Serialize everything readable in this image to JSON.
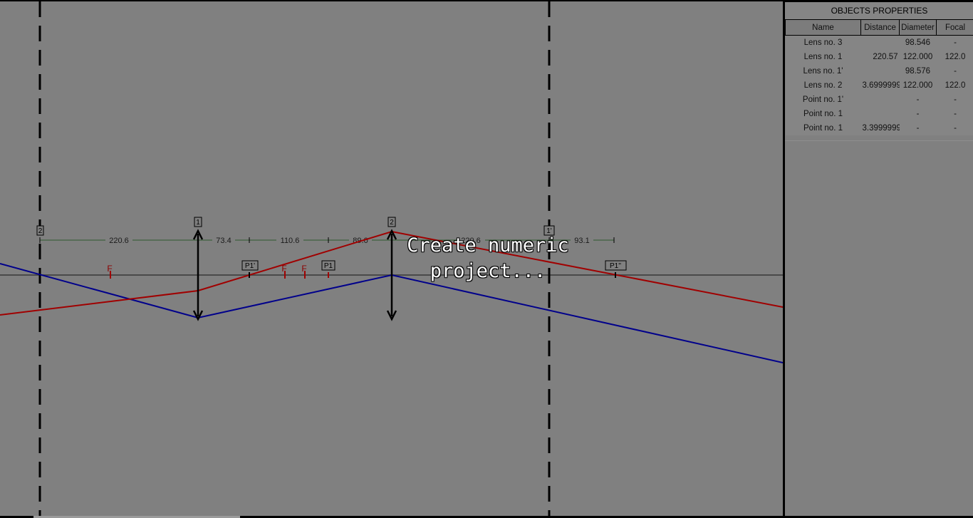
{
  "canvas": {
    "overlay_text": "Create numeric\nproject...",
    "lens_tags": [
      "2",
      "1",
      "2",
      "1'"
    ],
    "distances": [
      "220.6",
      "73.4",
      "110.6",
      "89.0",
      "220.6",
      "93.1"
    ],
    "point_tags": [
      "P1'",
      "P1",
      "P1''"
    ],
    "focal_labels": [
      "F",
      "F",
      "F"
    ],
    "colors": {
      "background": "#808080",
      "ray_red": "#a00000",
      "ray_blue": "#00008b",
      "dim_line": "#2e5a2e"
    }
  },
  "panel": {
    "title": "OBJECTS PROPERTIES",
    "columns": [
      "Name",
      "Distance",
      "Diameter",
      "Focal"
    ],
    "rows": [
      [
        "Lens no. 3",
        "",
        "98.546",
        "-"
      ],
      [
        "Lens no. 1",
        "220.57",
        "122.000",
        "122.0"
      ],
      [
        "Lens no. 1'",
        "",
        "98.576",
        "-"
      ],
      [
        "Lens no. 2",
        "3.699999999",
        "122.000",
        "122.0"
      ],
      [
        "Point no. 1'",
        "",
        "-",
        "-"
      ],
      [
        "Point no. 1",
        "",
        "-",
        "-"
      ],
      [
        "Point no. 1",
        "3.399999999",
        "-",
        "-"
      ]
    ]
  }
}
